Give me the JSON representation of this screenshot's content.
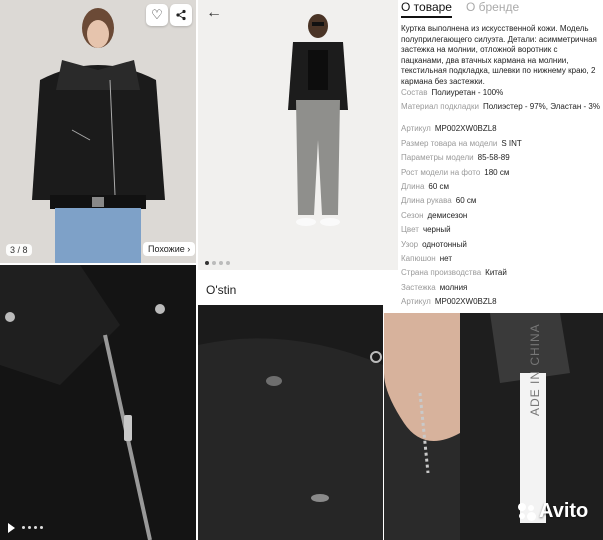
{
  "gallery": {
    "photo_counter": "3 / 8",
    "similar_label": "Похожие ›"
  },
  "tabs": [
    {
      "label": "О товаре"
    },
    {
      "label": "О бренде"
    }
  ],
  "description": "Куртка выполнена из искусственной кожи. Модель полуприлегающего силуэта. Детали: асимметричная застежка на молнии, отложной воротник с пацканами, два втачных кармана на молнии, текстильная подкладка, шлевки по нижнему краю, 2 кармана без застежки.",
  "specs": [
    {
      "key": "Состав",
      "value": "Полиуретан - 100%"
    },
    {
      "key": "Материал подкладки",
      "value": "Полиэстер - 97%, Эластан - 3%"
    },
    {
      "key": "Артикул",
      "value": "MP002XW0BZL8"
    },
    {
      "key": "Размер товара на модели",
      "value": "S INT"
    },
    {
      "key": "Параметры модели",
      "value": "85-58-89"
    },
    {
      "key": "Рост модели на фото",
      "value": "180 см"
    },
    {
      "key": "Длина",
      "value": "60 см"
    },
    {
      "key": "Длина рукава",
      "value": "60 см"
    },
    {
      "key": "Сезон",
      "value": "демисезон"
    },
    {
      "key": "Цвет",
      "value": "черный"
    },
    {
      "key": "Узор",
      "value": "однотонный"
    },
    {
      "key": "Капюшон",
      "value": "нет"
    },
    {
      "key": "Страна производства",
      "value": "Китай"
    },
    {
      "key": "Застежка",
      "value": "молния"
    },
    {
      "key": "Артикул",
      "value": "MP002XW0BZL8"
    }
  ],
  "brand": {
    "name": "O'stin"
  },
  "label_tag_text": "ADE IN CHINA",
  "watermark": "Avito",
  "icons": {
    "favorite": "heart-icon",
    "share": "share-icon",
    "back": "arrow-left-icon",
    "play": "play-icon"
  }
}
